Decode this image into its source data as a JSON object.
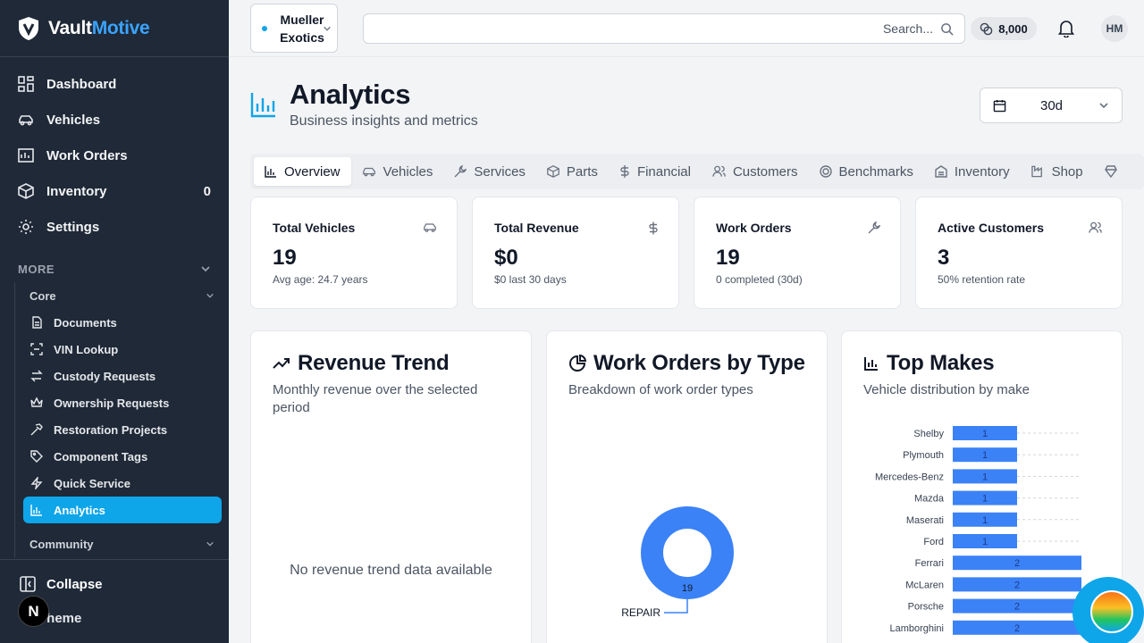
{
  "brand": {
    "part1": "Vault",
    "part2": "Motive"
  },
  "sidebar": {
    "items": [
      {
        "label": "Dashboard",
        "icon": "dashboard-icon"
      },
      {
        "label": "Vehicles",
        "icon": "car-icon"
      },
      {
        "label": "Work Orders",
        "icon": "work-orders-icon"
      },
      {
        "label": "Inventory",
        "icon": "box-icon",
        "count": "0"
      },
      {
        "label": "Settings",
        "icon": "gear-icon"
      }
    ],
    "more_label": "MORE",
    "core_label": "Core",
    "core_items": [
      {
        "label": "Documents"
      },
      {
        "label": "VIN Lookup"
      },
      {
        "label": "Custody Requests"
      },
      {
        "label": "Ownership Requests"
      },
      {
        "label": "Restoration Projects"
      },
      {
        "label": "Component Tags"
      },
      {
        "label": "Quick Service"
      },
      {
        "label": "Analytics"
      }
    ],
    "community_label": "Community",
    "collapse_label": "Collapse",
    "theme_label": "Theme",
    "n_badge": "N"
  },
  "topbar": {
    "org_line1": "Mueller",
    "org_line2": "Exotics",
    "search_placeholder": "Search...",
    "credits": "8,000",
    "avatar": "HM"
  },
  "page": {
    "title": "Analytics",
    "subtitle": "Business insights and metrics",
    "range": "30d"
  },
  "tabs": [
    "Overview",
    "Vehicles",
    "Services",
    "Parts",
    "Financial",
    "Customers",
    "Benchmarks",
    "Inventory",
    "Shop"
  ],
  "stats": [
    {
      "label": "Total Vehicles",
      "value": "19",
      "sub": "Avg age: 24.7 years"
    },
    {
      "label": "Total Revenue",
      "value": "$0",
      "sub": "$0 last 30 days"
    },
    {
      "label": "Work Orders",
      "value": "19",
      "sub": "0 completed (30d)"
    },
    {
      "label": "Active Customers",
      "value": "3",
      "sub": "50% retention rate"
    }
  ],
  "cards": {
    "revenue": {
      "title": "Revenue Trend",
      "desc": "Monthly revenue over the selected period",
      "empty": "No revenue trend data available"
    },
    "workorders": {
      "title": "Work Orders by Type",
      "desc": "Breakdown of work order types"
    },
    "topmakes": {
      "title": "Top Makes",
      "desc": "Vehicle distribution by make"
    }
  },
  "chart_data": [
    {
      "type": "pie",
      "title": "Work Orders by Type",
      "labels": [
        "REPAIR"
      ],
      "values": [
        19
      ],
      "colors": [
        "#3b82f6"
      ]
    },
    {
      "type": "bar",
      "orientation": "horizontal",
      "title": "Top Makes",
      "categories": [
        "Shelby",
        "Plymouth",
        "Mercedes-Benz",
        "Mazda",
        "Maserati",
        "Ford",
        "Ferrari",
        "McLaren",
        "Porsche",
        "Lamborghini"
      ],
      "values": [
        1,
        1,
        1,
        1,
        1,
        1,
        2,
        2,
        2,
        2
      ],
      "color": "#3b82f6",
      "xlim": [
        0,
        2
      ]
    }
  ]
}
